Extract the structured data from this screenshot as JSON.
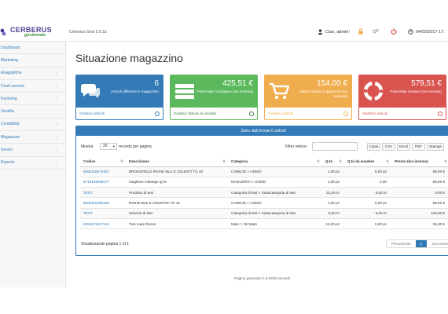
{
  "header": {
    "logo_title": "CERBERUS",
    "logo_sub": "gestionale",
    "app_name": "Cerberus Gest 0.0.1b",
    "user_label": "Ciao, admin!",
    "datetime": "04/02/2017 17:"
  },
  "sidebar": {
    "items": [
      {
        "label": "Dashboard",
        "chevron": false
      },
      {
        "label": "Marketing",
        "chevron": false
      },
      {
        "label": "Anagrafiche",
        "chevron": true
      },
      {
        "label": "Conti correnti",
        "chevron": true
      },
      {
        "label": "Factoring",
        "chevron": true
      },
      {
        "label": "Vendita",
        "chevron": false
      },
      {
        "label": "Contabilità",
        "chevron": true
      },
      {
        "label": "Magazzino",
        "chevron": true
      },
      {
        "label": "Servizi",
        "chevron": true
      },
      {
        "label": "Reports",
        "chevron": true
      }
    ]
  },
  "page": {
    "title": "Situazione magazzino",
    "footer": "Pagina generata in 0.0225 secondi"
  },
  "tiles": [
    {
      "value": "6",
      "label": "Articoli differenti in magazzino",
      "link": "Gestisci articoli",
      "icon": "chat-icon",
      "color": "#337ab7",
      "border": "#337ab7",
      "link_color": "#337ab7"
    },
    {
      "value": "425,51 €",
      "label": "Potenziale Guadagno (Iva esclusa)",
      "link": "Gestisci fatture di vendita",
      "icon": "list-icon",
      "color": "#5cb85c",
      "border": "#5cb85c",
      "link_color": "#3c763d"
    },
    {
      "value": "154,00 €",
      "label": "Valore articoli in giacenza (Iva esclusa)",
      "link": "Gestisci articoli",
      "icon": "cart-icon",
      "color": "#f0ad4e",
      "border": "#f0ad4e",
      "link_color": "#f0ad4e"
    },
    {
      "value": "579,51 €",
      "label": "Potenziale incasso (Iva esclusa)",
      "link": "Gestisci articoli",
      "icon": "lifebuoy-icon",
      "color": "#d9534f",
      "border": "#d9534f",
      "link_color": "#d9534f"
    }
  ],
  "panel": {
    "heading": "Sono stati trovati 6 articoli",
    "show_label": "Mostra",
    "show_value": "20",
    "show_after": "records per pagina",
    "filter_label": "Filtro veloce:",
    "filter_value": "",
    "buttons": [
      "Copia",
      "CSV",
      "Excel",
      "PDF",
      "Stampa"
    ]
  },
  "table": {
    "columns": [
      "Codice",
      "Descrizione",
      "Categoria",
      "Q.tà",
      "Q.tà da evadere",
      "Prezzo (Iva inclusa)"
    ],
    "rows": [
      [
        "8055116670307",
        "BRODSFIELD RIGHE BLU E CELESTI TG 40",
        "CAMICIE > UOMO",
        "1,00 pz",
        "0,00 pz",
        "99,00 €"
      ],
      [
        "8719109658177",
        "maglione melange tg M",
        "MAGLIERIA > UOMO",
        "1,00 pz",
        "0,00",
        "89,00 €"
      ],
      [
        "TEST",
        "Prodotto di test",
        "Categoria di test > Sottocategoria di test",
        "31,00 nr",
        "0,00 nr",
        "0,00 €"
      ],
      [
        "8055116490156",
        "RIGHE BLE E CELESTE TG 41",
        "CAMICIE > UOMO",
        "1,00 pz",
        "0,00 pz",
        "99,00 €"
      ],
      [
        "TEST",
        "Servizio di test",
        "Categoria di test > Sottocategoria di test",
        "0,00 nr",
        "0,00 nr",
        "120,00 €"
      ],
      [
        "5054679017110",
        "Toto mare frozen",
        "Mare > Tel Mare",
        "12,00 pz",
        "0,00 pz",
        "25,00 €"
      ]
    ]
  },
  "pager": {
    "info": "Visualizzando pagina 1 of 1",
    "prev": "Precedente",
    "current": "1",
    "next": "Successivo"
  }
}
